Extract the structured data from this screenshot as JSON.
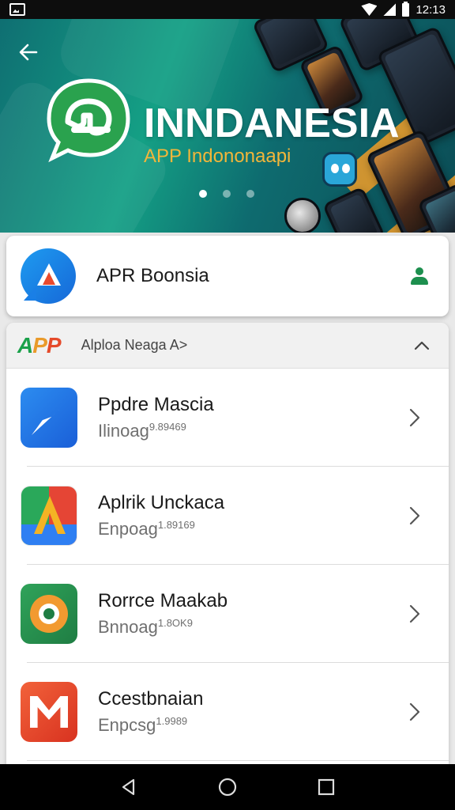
{
  "status_bar": {
    "time": "12:13",
    "icons": [
      "gallery-icon",
      "wifi-icon",
      "signal-icon",
      "battery-icon"
    ]
  },
  "hero": {
    "title": "INNDANESIA",
    "subtitle": "APP Indononaapi",
    "carousel_dots": 3,
    "active_dot": 0,
    "colors": {
      "teal": "#14a085",
      "accent": "#e49a2b",
      "subtitle": "#f2b63a"
    }
  },
  "profile": {
    "name": "APR Boonsia",
    "icon": "app-logo-icon",
    "action_icon": "person-icon"
  },
  "section": {
    "logo": {
      "a": "A",
      "p1": "P",
      "p2": "P"
    },
    "title": "Alploa Neaga A>",
    "expanded": true
  },
  "apps": [
    {
      "title": "Ppdre Mascia",
      "subtitle": "Ilinoag",
      "superscript": "9.89469",
      "icon": "paper-plane-icon"
    },
    {
      "title": "Aplrik Unckaca",
      "subtitle": "Enpoag",
      "superscript": "1.89169",
      "icon": "triangle-logo-icon"
    },
    {
      "title": "Rorrce Maakab",
      "subtitle": "Bnnoag",
      "superscript": "1.8OK9",
      "icon": "gear-icon"
    },
    {
      "title": "Ccestbnaian",
      "subtitle": "Enpcsg",
      "superscript": "1.9989",
      "icon": "m-logo-icon"
    }
  ],
  "nav": {
    "buttons": [
      "back-icon",
      "home-icon",
      "recents-icon"
    ]
  }
}
